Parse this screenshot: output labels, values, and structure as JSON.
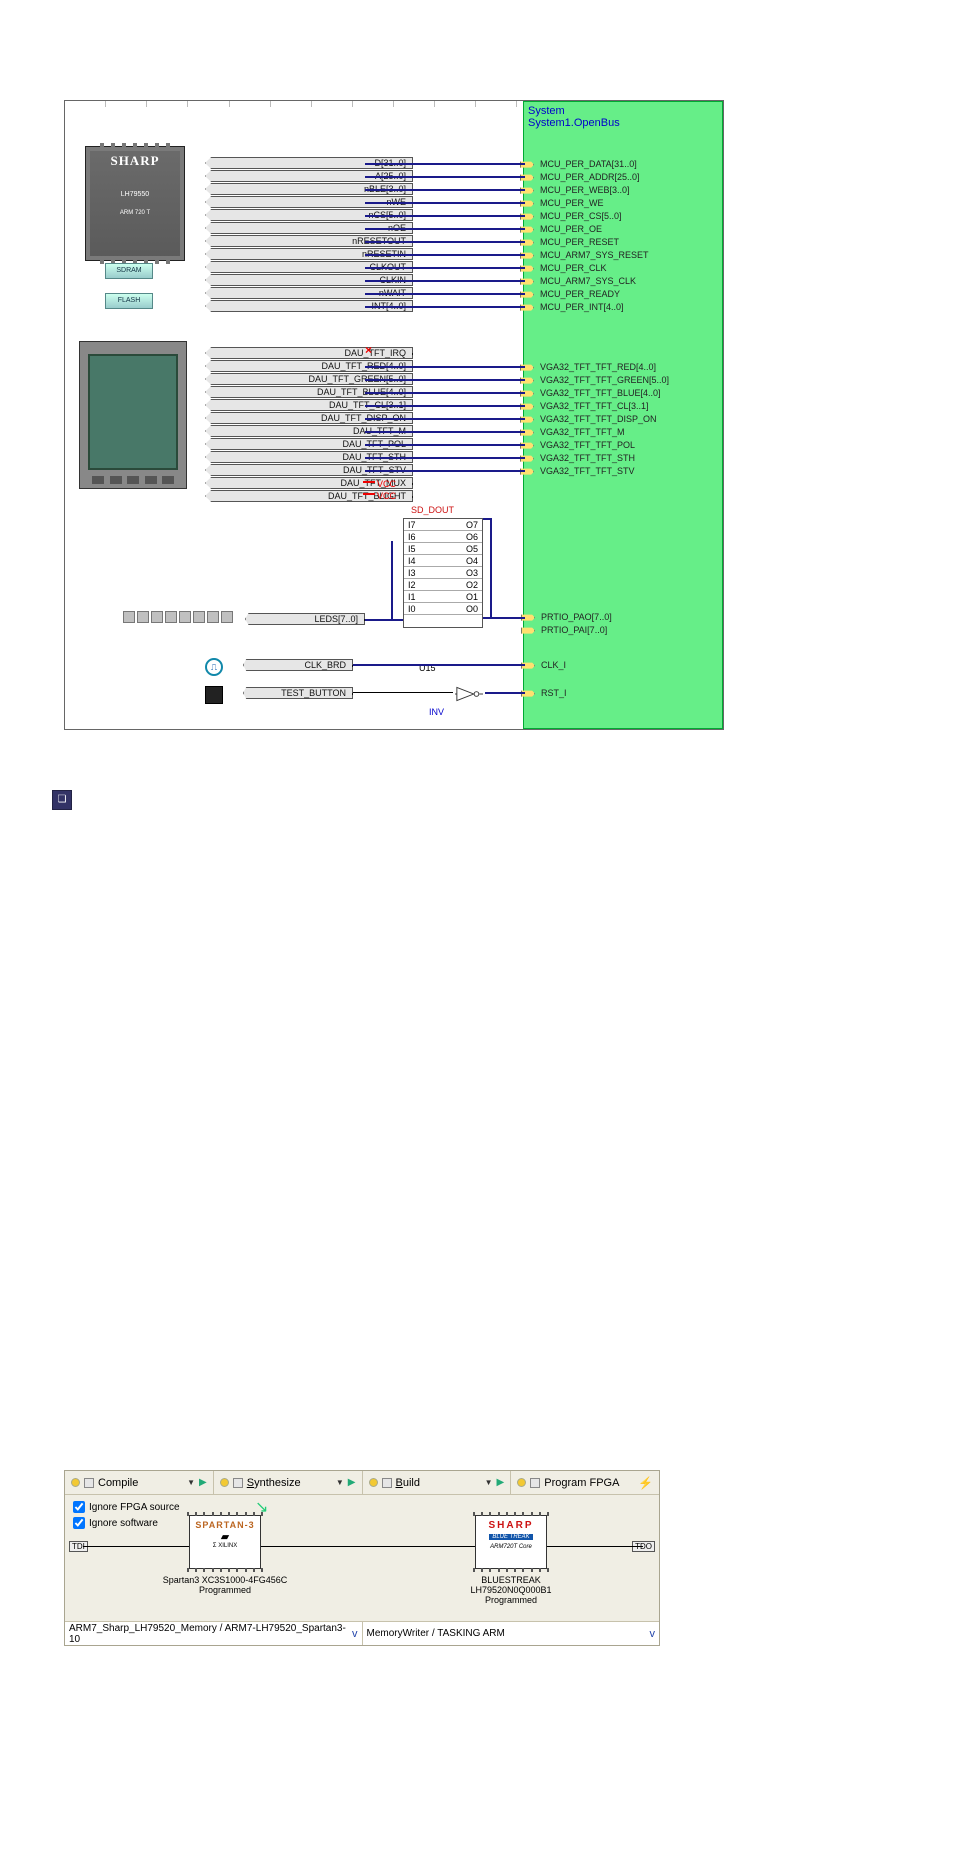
{
  "green_label": {
    "l1": "System",
    "l2": "System1.OpenBus"
  },
  "sharp_chip": {
    "title": "SHARP",
    "sub": "LH79550",
    "sub2": "ARM 720 T"
  },
  "mem": {
    "sdram": "SDRAM",
    "flash": "FLASH"
  },
  "bus1_left": [
    "D[31..0]",
    "A[25..0]",
    "nBLE[3..0]",
    "nWE",
    "nCS[5..0]",
    "nOE",
    "nRESETOUT",
    "nRESETIN",
    "CLKOUT",
    "CLKIN",
    "nWAIT",
    "INT[4..0]"
  ],
  "bus1_right": [
    "MCU_PER_DATA[31..0]",
    "MCU_PER_ADDR[25..0]",
    "MCU_PER_WEB[3..0]",
    "MCU_PER_WE",
    "MCU_PER_CS[5..0]",
    "MCU_PER_OE",
    "MCU_PER_RESET",
    "MCU_ARM7_SYS_RESET",
    "MCU_PER_CLK",
    "MCU_ARM7_SYS_CLK",
    "MCU_PER_READY",
    "MCU_PER_INT[4..0]"
  ],
  "bus2_left": [
    "DAU_TFT_IRQ",
    "DAU_TFT_RED[4..0]",
    "DAU_TFT_GREEN[5..0]",
    "DAU_TFT_BLUE[4..0]",
    "DAU_TFT_CL[3..1]",
    "DAU_TFT_DISP_ON",
    "DAU_TFT_M",
    "DAU_TFT_POL",
    "DAU_TFT_STH",
    "DAU_TFT_STV",
    "DAU_TFT_MUX",
    "DAU_TFT_BLIGHT"
  ],
  "bus2_right": [
    "VGA32_TFT_TFT_RED[4..0]",
    "VGA32_TFT_TFT_GREEN[5..0]",
    "VGA32_TFT_TFT_BLUE[4..0]",
    "VGA32_TFT_TFT_CL[3..1]",
    "VGA32_TFT_TFT_DISP_ON",
    "VGA32_TFT_TFT_M",
    "VGA32_TFT_TFT_POL",
    "VGA32_TFT_TFT_STH",
    "VGA32_TFT_TFT_STV"
  ],
  "sd_dout": "SD_DOUT",
  "buf8_left": [
    "I7",
    "I6",
    "I5",
    "I4",
    "I3",
    "I2",
    "I1",
    "I0"
  ],
  "buf8_right": [
    "O7",
    "O6",
    "O5",
    "O4",
    "O3",
    "O2",
    "O1",
    "O0"
  ],
  "leds": "LEDS[7..0]",
  "prtio": {
    "pao": "PRTIO_PAO[7..0]",
    "pai": "PRTIO_PAI[7..0]"
  },
  "clk_brd": "CLK_BRD",
  "test_button": "TEST_BUTTON",
  "clk_i": "CLK_I",
  "rst_i": "RST_I",
  "u15": "U15",
  "inv": "INV",
  "vcc": {
    "a": "VCC",
    "b": "VCC"
  },
  "toolbar": {
    "compile": "Compile",
    "synth": "Synthesize",
    "build": "Build",
    "prog": "Program FPGA"
  },
  "options": {
    "fpga": "Ignore FPGA source",
    "sw": "Ignore software"
  },
  "tdi": "TDI",
  "tdo": "TDO",
  "chipA": {
    "brand": "SPARTAN-3",
    "vendor": "XILINX",
    "part": "Spartan3 XC3S1000-4FG456C",
    "state": "Programmed"
  },
  "chipB": {
    "brand": "SHARP",
    "tag": "BLUE   TREAK",
    "core": "ARM720T Core",
    "part": "BLUESTREAK LH79520N0Q000B1",
    "state": "Programmed"
  },
  "combo1": "ARM7_Sharp_LH79520_Memory / ARM7-LH79520_Spartan3-10",
  "combo2": "MemoryWriter / TASKING ARM",
  "sigma": "Σ"
}
